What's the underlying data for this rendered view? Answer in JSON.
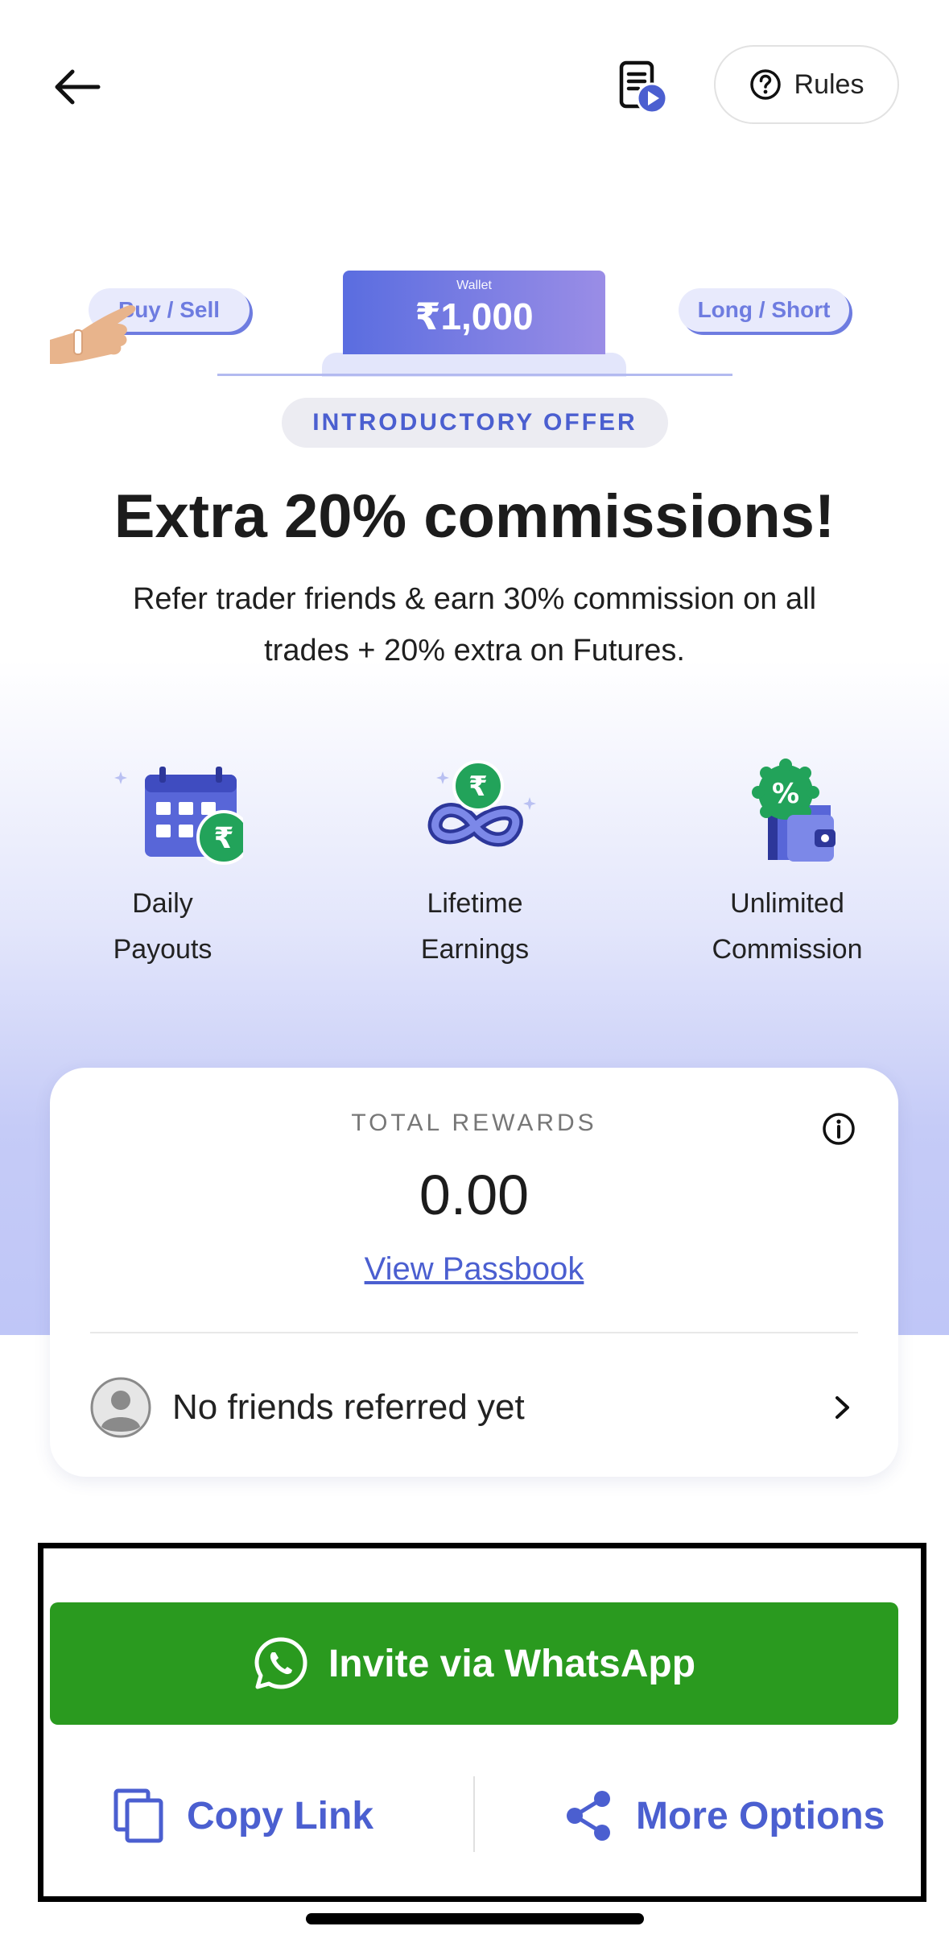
{
  "header": {
    "back_icon": "arrow-left-icon",
    "video_guide_icon": "video-guide-icon",
    "rules_label": "Rules"
  },
  "banner": {
    "buy_sell_label": "Buy / Sell",
    "long_short_label": "Long / Short",
    "wallet_label": "Wallet",
    "wallet_amount": "₹1,000"
  },
  "offer": {
    "badge": "INTRODUCTORY OFFER",
    "headline": "Extra 20% commissions!",
    "subtext": "Refer trader friends & earn 30% commission on all trades + 20% extra on Futures."
  },
  "features": [
    {
      "line1": "Daily",
      "line2": "Payouts",
      "icon": "calendar-rupee-icon"
    },
    {
      "line1": "Lifetime",
      "line2": "Earnings",
      "icon": "infinity-rupee-icon"
    },
    {
      "line1": "Unlimited",
      "line2": "Commission",
      "icon": "wallet-percent-icon"
    }
  ],
  "rewards": {
    "title": "TOTAL REWARDS",
    "value": "0.00",
    "passbook_link": "View Passbook",
    "friends_text": "No friends referred yet"
  },
  "actions": {
    "whatsapp_label": "Invite via WhatsApp",
    "copy_link_label": "Copy Link",
    "more_options_label": "More Options"
  },
  "colors": {
    "accent": "#4b5fd0",
    "whatsapp_green": "#2a9a1f",
    "rupee_green": "#22a35a"
  }
}
